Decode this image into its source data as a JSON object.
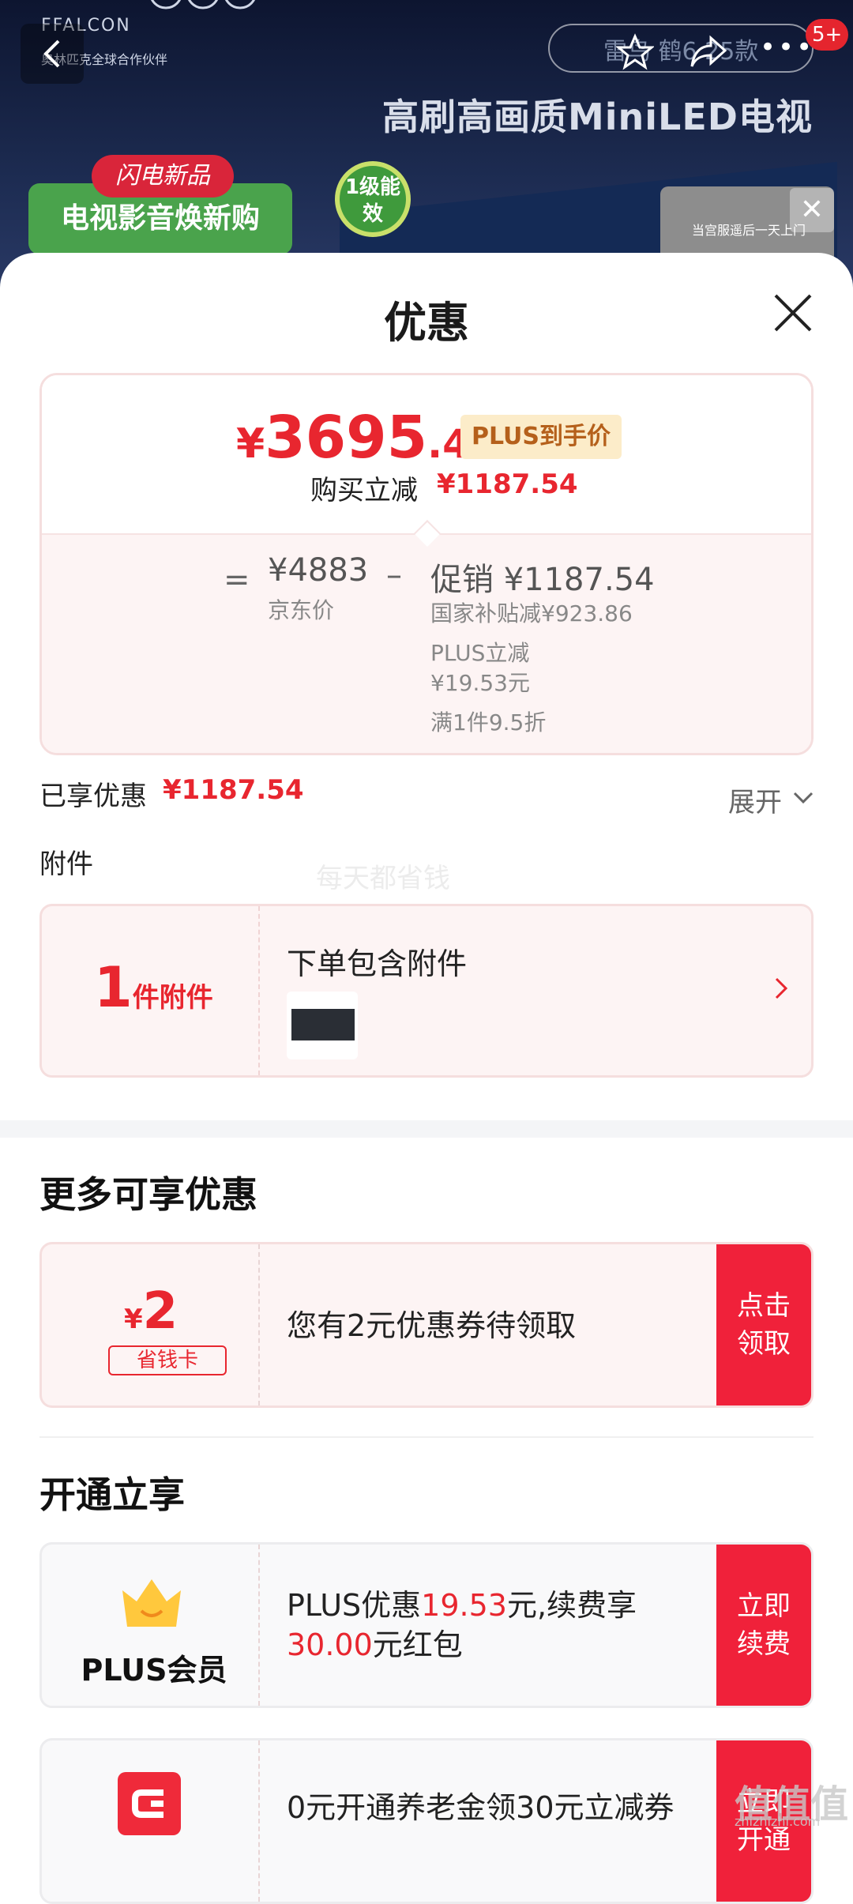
{
  "background": {
    "brand": "FFALCON",
    "brand_sub": "奥林匹克全球合作伙伴",
    "search_text": "雷鸟 鹤6 25款",
    "notification_count": "5+",
    "hero_title": "高刷高画质MiniLED电视",
    "new_tag": "闪电新品",
    "promo_text": "电视影音焕新购",
    "energy_label": "1级能效",
    "float_card_text": "当宫服遥后一天上门"
  },
  "sheet": {
    "title": "优惠",
    "price_card": {
      "currency": "¥",
      "final_int": "3695",
      "final_dec": ".46",
      "plus_tag": "PLUS到手价",
      "instant_label": "购买立减",
      "instant_amount": "¥1187.54",
      "eq": "=",
      "jd_price": "¥4883",
      "jd_label": "京东价",
      "minus": "–",
      "promo_label": "促销 ¥1187.54",
      "promo_lines": [
        "国家补贴减¥923.86",
        "PLUS立减",
        "¥19.53元",
        "满1件9.5折"
      ]
    },
    "enjoyed_label": "已享优惠",
    "enjoyed_amount": "¥1187.54",
    "expand_label": "展开",
    "accessory_heading": "附件",
    "watermark": "每天都省钱",
    "accessory": {
      "count": "1",
      "unit": "件附件",
      "title": "下单包含附件"
    },
    "more_offers_title": "更多可享优惠",
    "coupon": {
      "currency": "¥",
      "value": "2",
      "tag": "省钱卡",
      "text": "您有2元优惠券待领取",
      "cta": "点击领取"
    },
    "open_title": "开通立享",
    "plus_offer": {
      "name": "PLUS会员",
      "text_a": "PLUS优惠",
      "text_b": "19.53",
      "text_c": "元,续费享",
      "text_d": "30.00",
      "text_e": "元红包",
      "cta": "立即续费"
    },
    "pension_offer": {
      "text": "0元开通养老金领30元立减券",
      "cta": "立即开通"
    }
  },
  "site_watermark": "值值值",
  "site_watermark_url": "zhizhizhi.com"
}
